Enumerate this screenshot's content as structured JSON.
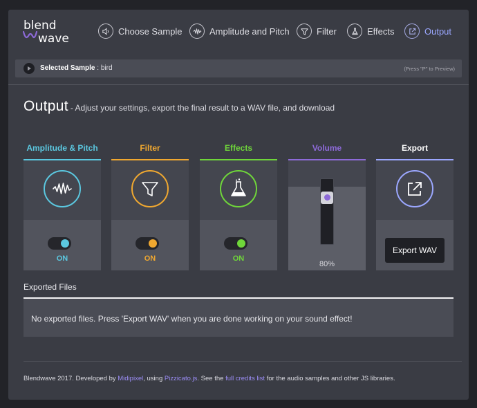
{
  "logo": {
    "line1": "blend",
    "line2": "wave"
  },
  "nav": [
    {
      "label": "Choose Sample",
      "icon": "speaker-icon",
      "active": false
    },
    {
      "label": "Amplitude and Pitch",
      "icon": "waveform-icon",
      "active": false
    },
    {
      "label": "Filter",
      "icon": "funnel-icon",
      "active": false
    },
    {
      "label": "Effects",
      "icon": "flask-icon",
      "active": false
    },
    {
      "label": "Output",
      "icon": "external-link-icon",
      "active": true
    }
  ],
  "sample_bar": {
    "label": "Selected Sample",
    "separator": " : ",
    "value": "bird",
    "hint": "(Press \"P\" to Preview)"
  },
  "page": {
    "title": "Output",
    "description": "- Adjust your settings, export the final result to a WAV file, and download"
  },
  "cards": {
    "amplitude": {
      "title": "Amplitude & Pitch",
      "state": "ON",
      "color": "#5bc8e0",
      "icon": "waveform-icon"
    },
    "filter": {
      "title": "Filter",
      "state": "ON",
      "color": "#f0a830",
      "icon": "funnel-icon"
    },
    "effects": {
      "title": "Effects",
      "state": "ON",
      "color": "#6fd63a",
      "icon": "flask-icon"
    },
    "volume": {
      "title": "Volume",
      "value_label": "80%",
      "level": 0.8,
      "color": "#8d6ad8"
    },
    "export": {
      "title": "Export",
      "button_label": "Export WAV",
      "color": "#9ba7ff",
      "icon": "external-link-icon"
    }
  },
  "exported_files": {
    "title": "Exported Files",
    "empty_message": "No exported files. Press 'Export WAV' when you are done working on your sound effect!"
  },
  "footer": {
    "text1": "Blendwave 2017. Developed by ",
    "link1": "Midipixel",
    "text2": ", using ",
    "link2": "Pizzicato.js",
    "text3": ". See the ",
    "link3": "full credits list",
    "text4": " for the audio samples and other JS libraries."
  }
}
